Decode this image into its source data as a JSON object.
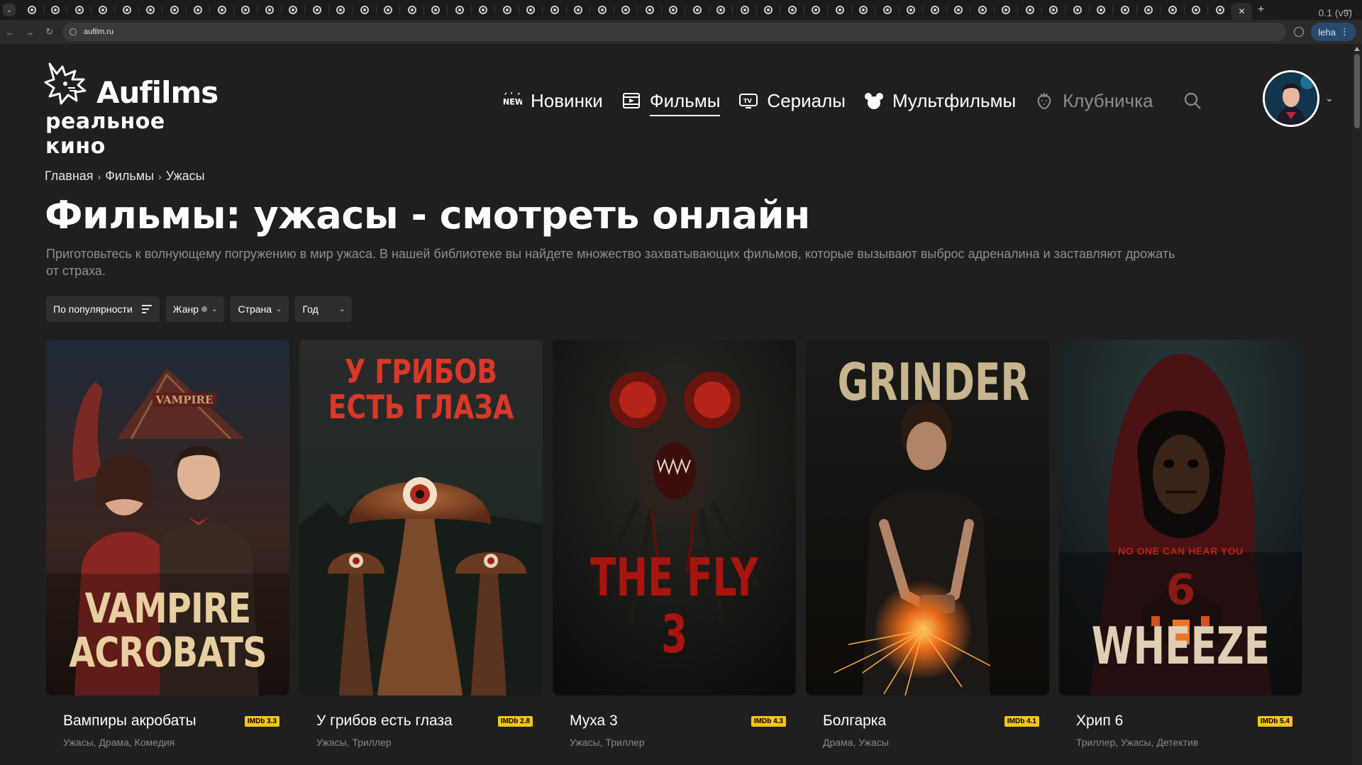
{
  "browser": {
    "url": "aufilm.ru",
    "profile_name": "leha",
    "version_label": "0.1 (v9)",
    "tab_count": 52
  },
  "site": {
    "logo_name": "Aufilms",
    "logo_tagline": "реальное кино"
  },
  "nav": {
    "items": [
      {
        "label": "Новинки",
        "icon": "new-icon",
        "active": false,
        "muted": false
      },
      {
        "label": "Фильмы",
        "icon": "film-icon",
        "active": true,
        "muted": false
      },
      {
        "label": "Сериалы",
        "icon": "tv-icon",
        "active": false,
        "muted": false
      },
      {
        "label": "Мультфильмы",
        "icon": "mickey-icon",
        "active": false,
        "muted": false
      },
      {
        "label": "Клубничка",
        "icon": "strawberry-icon",
        "active": false,
        "muted": true
      }
    ]
  },
  "breadcrumb": [
    "Главная",
    "Фильмы",
    "Ужасы"
  ],
  "page": {
    "title": "Фильмы: ужасы - смотреть онлайн",
    "description": "Приготовьтесь к волнующему погружению в мир ужаса. В нашей библиотеке вы найдете множество захватывающих фильмов, которые вызывают выброс адреналина и заставляют дрожать от страха."
  },
  "filters": {
    "sort": "По популярности",
    "genre": "Жанр",
    "country": "Страна",
    "year": "Год"
  },
  "movies": [
    {
      "title": "Вампиры акробаты",
      "imdb": "IMDb 3.3",
      "genres": "Ужасы, Драма, Комедия",
      "poster_text": [
        "VAMPIRE",
        "ACROBATS"
      ],
      "poster_sign": "VAMPIRE"
    },
    {
      "title": "У грибов есть глаза",
      "imdb": "IMDb 2.8",
      "genres": "Ужасы, Триллер",
      "poster_text": [
        "У ГРИБОВ",
        "ЕСТЬ ГЛАЗА"
      ]
    },
    {
      "title": "Муха 3",
      "imdb": "IMDb 4.3",
      "genres": "Ужасы, Триллер",
      "poster_text": [
        "THE FLY 3"
      ]
    },
    {
      "title": "Болгарка",
      "imdb": "IMDb 4.1",
      "genres": "Драма, Ужасы",
      "poster_text": [
        "GRINDER"
      ]
    },
    {
      "title": "Хрип 6",
      "imdb": "IMDb 5.4",
      "genres": "Триллер, Ужасы, Детектив",
      "poster_text": [
        "NO ONE CAN HEAR YOU",
        "WHEEZE",
        "6"
      ]
    }
  ],
  "colors": {
    "page_bg": "#1f1f1f",
    "imdb_yellow": "#f5c518",
    "muted_text": "#8f8f8f"
  }
}
